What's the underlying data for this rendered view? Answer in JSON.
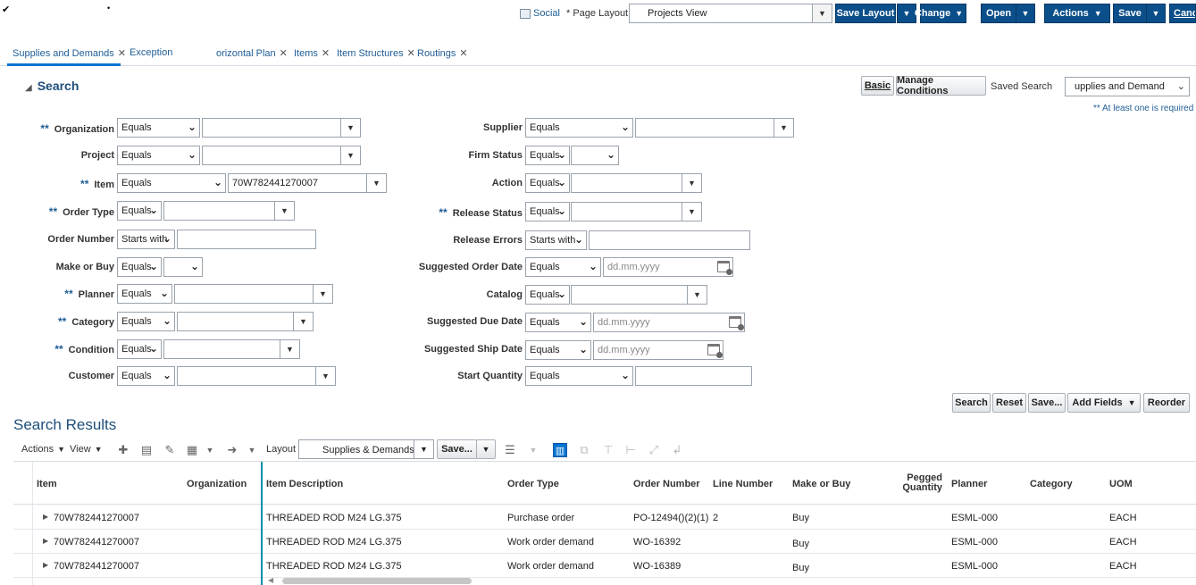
{
  "top": {
    "social_label": "Social",
    "page_layout_label": "Page Layout",
    "page_layout_value": "Projects View",
    "buttons": {
      "save_layout": "Save Layout",
      "change": "Change",
      "open": "Open",
      "actions": "Actions",
      "save": "Save",
      "cancel": "Canc"
    }
  },
  "tabs": [
    {
      "label": "Supplies and Demands"
    },
    {
      "label": "Exception"
    },
    {
      "label": "orizontal Plan"
    },
    {
      "label": "Items"
    },
    {
      "label": "Item Structures"
    },
    {
      "label": "Routings"
    }
  ],
  "search": {
    "title": "Search",
    "basic_label": "Basic",
    "manage_conditions_label": "Manage Conditions",
    "saved_search_label": "Saved Search",
    "saved_search_value": "upplies and Demand",
    "required_note": "** At least one is required",
    "required_marker": "**",
    "fields_left": {
      "organization": {
        "label": "Organization",
        "op": "Equals",
        "value": ""
      },
      "project": {
        "label": "Project",
        "op": "Equals",
        "value": ""
      },
      "item": {
        "label": "Item",
        "op": "Equals",
        "value": "70W782441270007"
      },
      "order_type": {
        "label": "Order Type",
        "op": "Equals",
        "value": ""
      },
      "order_number": {
        "label": "Order Number",
        "op": "Starts with",
        "value": ""
      },
      "make_or_buy": {
        "label": "Make or Buy",
        "op": "Equals",
        "value": ""
      },
      "planner": {
        "label": "Planner",
        "op": "Equals",
        "value": ""
      },
      "category": {
        "label": "Category",
        "op": "Equals",
        "value": ""
      },
      "condition": {
        "label": "Condition",
        "op": "Equals",
        "value": ""
      },
      "customer": {
        "label": "Customer",
        "op": "Equals",
        "value": ""
      }
    },
    "fields_right": {
      "supplier": {
        "label": "Supplier",
        "op": "Equals",
        "value": ""
      },
      "firm_status": {
        "label": "Firm Status",
        "op": "Equals",
        "value": ""
      },
      "action": {
        "label": "Action",
        "op": "Equals",
        "value": ""
      },
      "release_status": {
        "label": "Release Status",
        "op": "Equals",
        "value": ""
      },
      "release_errors": {
        "label": "Release Errors",
        "op": "Starts with",
        "value": ""
      },
      "suggested_order_date": {
        "label": "Suggested Order Date",
        "op": "Equals",
        "placeholder": "dd.mm.yyyy"
      },
      "catalog": {
        "label": "Catalog",
        "op": "Equals",
        "value": ""
      },
      "suggested_due_date": {
        "label": "Suggested Due Date",
        "op": "Equals",
        "placeholder": "dd.mm.yyyy"
      },
      "suggested_ship_date": {
        "label": "Suggested Ship Date",
        "op": "Equals",
        "placeholder": "dd.mm.yyyy"
      },
      "start_quantity": {
        "label": "Start Quantity",
        "op": "Equals",
        "value": ""
      }
    },
    "buttons": {
      "search": "Search",
      "reset": "Reset",
      "save": "Save...",
      "add_fields": "Add Fields",
      "reorder": "Reorder"
    }
  },
  "results": {
    "title": "Search Results",
    "actions_label": "Actions",
    "view_label": "View",
    "layout_label": "Layout",
    "layout_value": "Supplies & Demands",
    "save_label": "Save...",
    "columns": {
      "item": "Item",
      "organization": "Organization",
      "item_description": "Item Description",
      "order_type": "Order Type",
      "order_number": "Order Number",
      "line_number": "Line Number",
      "make_or_buy": "Make or Buy",
      "pegged_quantity_1": "Pegged",
      "pegged_quantity_2": "Quantity",
      "planner": "Planner",
      "category": "Category",
      "uom": "UOM"
    },
    "rows": [
      {
        "item": "70W782441270007",
        "description": "THREADED ROD M24 LG.375",
        "order_type": "Purchase order",
        "order_number": "PO-12494()(2)(1)",
        "line_number": "2",
        "make_or_buy": "Buy",
        "planner": "ESML-000",
        "uom": "EACH"
      },
      {
        "item": "70W782441270007",
        "description": "THREADED ROD M24 LG.375",
        "order_type": "Work order demand",
        "order_number": "WO-16392",
        "line_number": "",
        "make_or_buy": "Buy",
        "planner": "ESML-000",
        "uom": "EACH"
      },
      {
        "item": "70W782441270007",
        "description": "THREADED ROD M24 LG.375",
        "order_type": "Work order demand",
        "order_number": "WO-16389",
        "line_number": "",
        "make_or_buy": "Buy",
        "planner": "ESML-000",
        "uom": "EACH"
      }
    ]
  },
  "colors": {
    "accent_button": "#0b4f8a",
    "link": "#1e5c95",
    "tab_underline": "#0572ce",
    "freeze_line": "#0a8fa8"
  }
}
